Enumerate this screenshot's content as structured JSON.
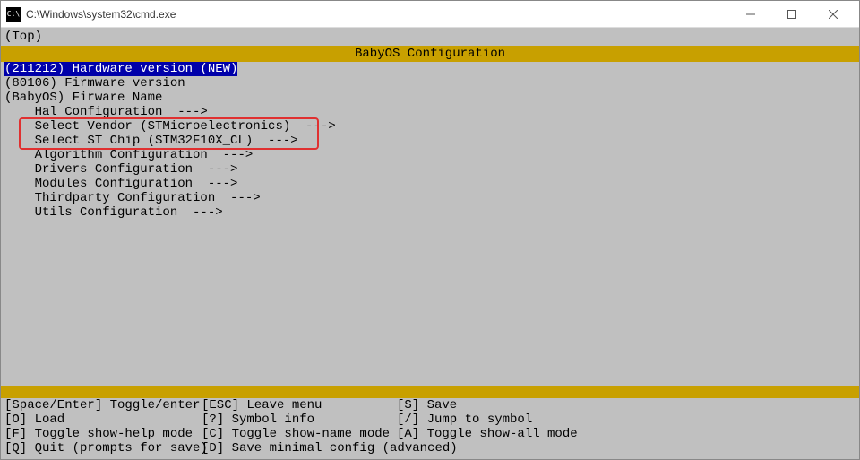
{
  "window": {
    "title": "C:\\Windows\\system32\\cmd.exe"
  },
  "top_label": "(Top)",
  "banner": "BabyOS Configuration",
  "menu": {
    "selected": "(211212) Hardware version (NEW)",
    "lines": [
      "(80106) Firmware version",
      "(BabyOS) Firware Name",
      "    Hal Configuration  --->",
      "    Select Vendor (STMicroelectronics)  --->",
      "    Select ST Chip (STM32F10X_CL)  --->",
      "    Algorithm Configuration  --->",
      "    Drivers Configuration  --->",
      "    Modules Configuration  --->",
      "    Thirdparty Configuration  --->",
      "    Utils Configuration  --->"
    ]
  },
  "help": {
    "rows": [
      [
        "[Space/Enter] Toggle/enter",
        "[ESC] Leave menu",
        "[S] Save"
      ],
      [
        "[O] Load",
        "[?] Symbol info",
        "[/] Jump to symbol"
      ],
      [
        "[F] Toggle show-help mode",
        "[C] Toggle show-name mode",
        "[A] Toggle show-all mode"
      ],
      [
        "[Q] Quit (prompts for save)",
        "[D] Save minimal config (advanced)",
        ""
      ]
    ]
  }
}
